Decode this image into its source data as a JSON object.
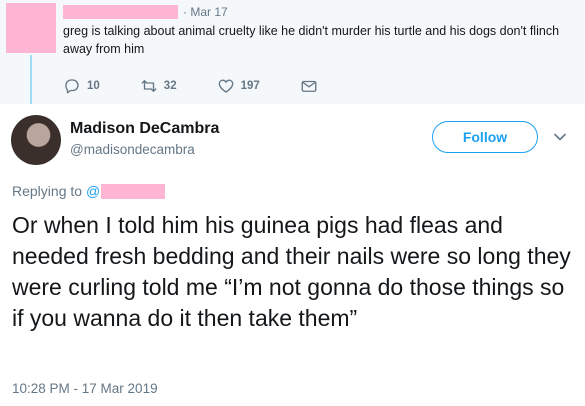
{
  "parent_tweet": {
    "date": "· Mar 17",
    "text": "greg is talking about animal cruelty like he didn't murder his turtle and his dogs don't flinch away from him",
    "actions": {
      "reply_count": "10",
      "retweet_count": "32",
      "like_count": "197"
    },
    "icons": [
      "reply-icon",
      "retweet-icon",
      "like-icon",
      "direct-message-icon"
    ]
  },
  "tweet": {
    "author_name": "Madison DeCambra",
    "author_handle": "@madisondecambra",
    "follow_label": "Follow",
    "replying_to_label": "Replying to",
    "replying_to_at": "@",
    "text": "Or when I told him his guinea pigs had fleas and needed fresh bedding and their nails were so long they were curling told me “I’m not gonna do those things so if you wanna do it then take them”",
    "timestamp": "10:28 PM - 17 Mar 2019"
  },
  "colors": {
    "accent": "#1da1f2",
    "muted": "#657786",
    "redaction": "#ffb6d5",
    "thread_line": "#9edcf1"
  }
}
